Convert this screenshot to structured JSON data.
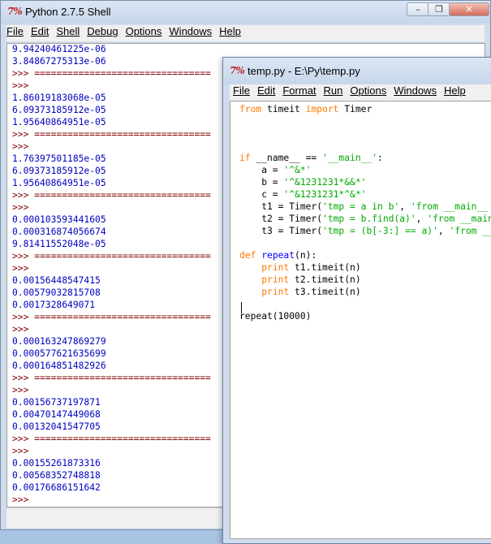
{
  "shell": {
    "title": "Python 2.7.5 Shell",
    "menu": [
      "File",
      "Edit",
      "Shell",
      "Debug",
      "Options",
      "Windows",
      "Help"
    ],
    "lines": [
      {
        "t": "9.94240461225e-06",
        "k": "out"
      },
      {
        "t": "3.84867275313e-06",
        "k": "out"
      },
      {
        "t": ">>> ================================",
        "k": "prm"
      },
      {
        "t": ">>>",
        "k": "prm"
      },
      {
        "t": "1.86019183068e-05",
        "k": "out"
      },
      {
        "t": "6.09373185912e-05",
        "k": "out"
      },
      {
        "t": "1.95640864951e-05",
        "k": "out"
      },
      {
        "t": ">>> ================================",
        "k": "prm"
      },
      {
        "t": ">>>",
        "k": "prm"
      },
      {
        "t": "1.76397501185e-05",
        "k": "out"
      },
      {
        "t": "6.09373185912e-05",
        "k": "out"
      },
      {
        "t": "1.95640864951e-05",
        "k": "out"
      },
      {
        "t": ">>> ================================",
        "k": "prm"
      },
      {
        "t": ">>>",
        "k": "prm"
      },
      {
        "t": "0.000103593441605",
        "k": "out"
      },
      {
        "t": "0.000316874056674",
        "k": "out"
      },
      {
        "t": "9.81411552048e-05",
        "k": "out"
      },
      {
        "t": ">>> ================================",
        "k": "prm"
      },
      {
        "t": ">>>",
        "k": "prm"
      },
      {
        "t": "0.00156448547415",
        "k": "out"
      },
      {
        "t": "0.00579032815708",
        "k": "out"
      },
      {
        "t": "0.0017328649071",
        "k": "out"
      },
      {
        "t": ">>> ================================",
        "k": "prm"
      },
      {
        "t": ">>>",
        "k": "prm"
      },
      {
        "t": "0.000163247869279",
        "k": "out"
      },
      {
        "t": "0.000577621635699",
        "k": "out"
      },
      {
        "t": "0.000164851482926",
        "k": "out"
      },
      {
        "t": ">>> ================================",
        "k": "prm"
      },
      {
        "t": ">>>",
        "k": "prm"
      },
      {
        "t": "0.00156737197871",
        "k": "out"
      },
      {
        "t": "0.00470147449068",
        "k": "out"
      },
      {
        "t": "0.00132041547705",
        "k": "out"
      },
      {
        "t": ">>> ================================",
        "k": "prm"
      },
      {
        "t": ">>>",
        "k": "prm"
      },
      {
        "t": "0.00155261873316",
        "k": "out"
      },
      {
        "t": "0.00568352748818",
        "k": "out"
      },
      {
        "t": "0.00176686151642",
        "k": "out"
      },
      {
        "t": ">>>",
        "k": "prm"
      }
    ]
  },
  "editor": {
    "title": "temp.py - E:\\Py\\temp.py",
    "menu": [
      "File",
      "Edit",
      "Format",
      "Run",
      "Options",
      "Windows",
      "Help"
    ],
    "code": [
      [
        [
          "from",
          "kw"
        ],
        [
          " timeit ",
          ""
        ],
        [
          "import",
          "kw"
        ],
        [
          " Timer",
          ""
        ]
      ],
      [],
      [],
      [],
      [
        [
          "if",
          "kw"
        ],
        [
          " __name__ == ",
          ""
        ],
        [
          "'__main__'",
          "st"
        ],
        [
          ":",
          ""
        ]
      ],
      [
        [
          "    a = ",
          ""
        ],
        [
          "'^&*'",
          "st"
        ]
      ],
      [
        [
          "    b = ",
          ""
        ],
        [
          "'^&1231231*&&*'",
          "st"
        ]
      ],
      [
        [
          "    c = ",
          ""
        ],
        [
          "'^&1231231*^&*'",
          "st"
        ]
      ],
      [
        [
          "    t1 = Timer(",
          ""
        ],
        [
          "'tmp = a in b'",
          "st"
        ],
        [
          ", ",
          ""
        ],
        [
          "'from __main__ import a, b'",
          "st"
        ],
        [
          ")",
          ""
        ]
      ],
      [
        [
          "    t2 = Timer(",
          ""
        ],
        [
          "'tmp = b.find(a)'",
          "st"
        ],
        [
          ", ",
          ""
        ],
        [
          "'from __main__ import a, b'",
          "st"
        ],
        [
          ")",
          ""
        ]
      ],
      [
        [
          "    t3 = Timer(",
          ""
        ],
        [
          "'tmp = (b[-3:] == a)'",
          "st"
        ],
        [
          ", ",
          ""
        ],
        [
          "'from __main__ import a, b'",
          "st"
        ],
        [
          ")",
          ""
        ]
      ],
      [],
      [
        [
          "def",
          "kw"
        ],
        [
          " ",
          ""
        ],
        [
          "repeat",
          "df"
        ],
        [
          "(n):",
          ""
        ]
      ],
      [
        [
          "    ",
          ""
        ],
        [
          "print",
          "kw"
        ],
        [
          " t1.timeit(n)",
          ""
        ]
      ],
      [
        [
          "    ",
          ""
        ],
        [
          "print",
          "kw"
        ],
        [
          " t2.timeit(n)",
          ""
        ]
      ],
      [
        [
          "    ",
          ""
        ],
        [
          "print",
          "kw"
        ],
        [
          " t3.timeit(n)",
          ""
        ]
      ],
      [],
      [
        [
          "repeat(10000)",
          ""
        ]
      ]
    ]
  }
}
